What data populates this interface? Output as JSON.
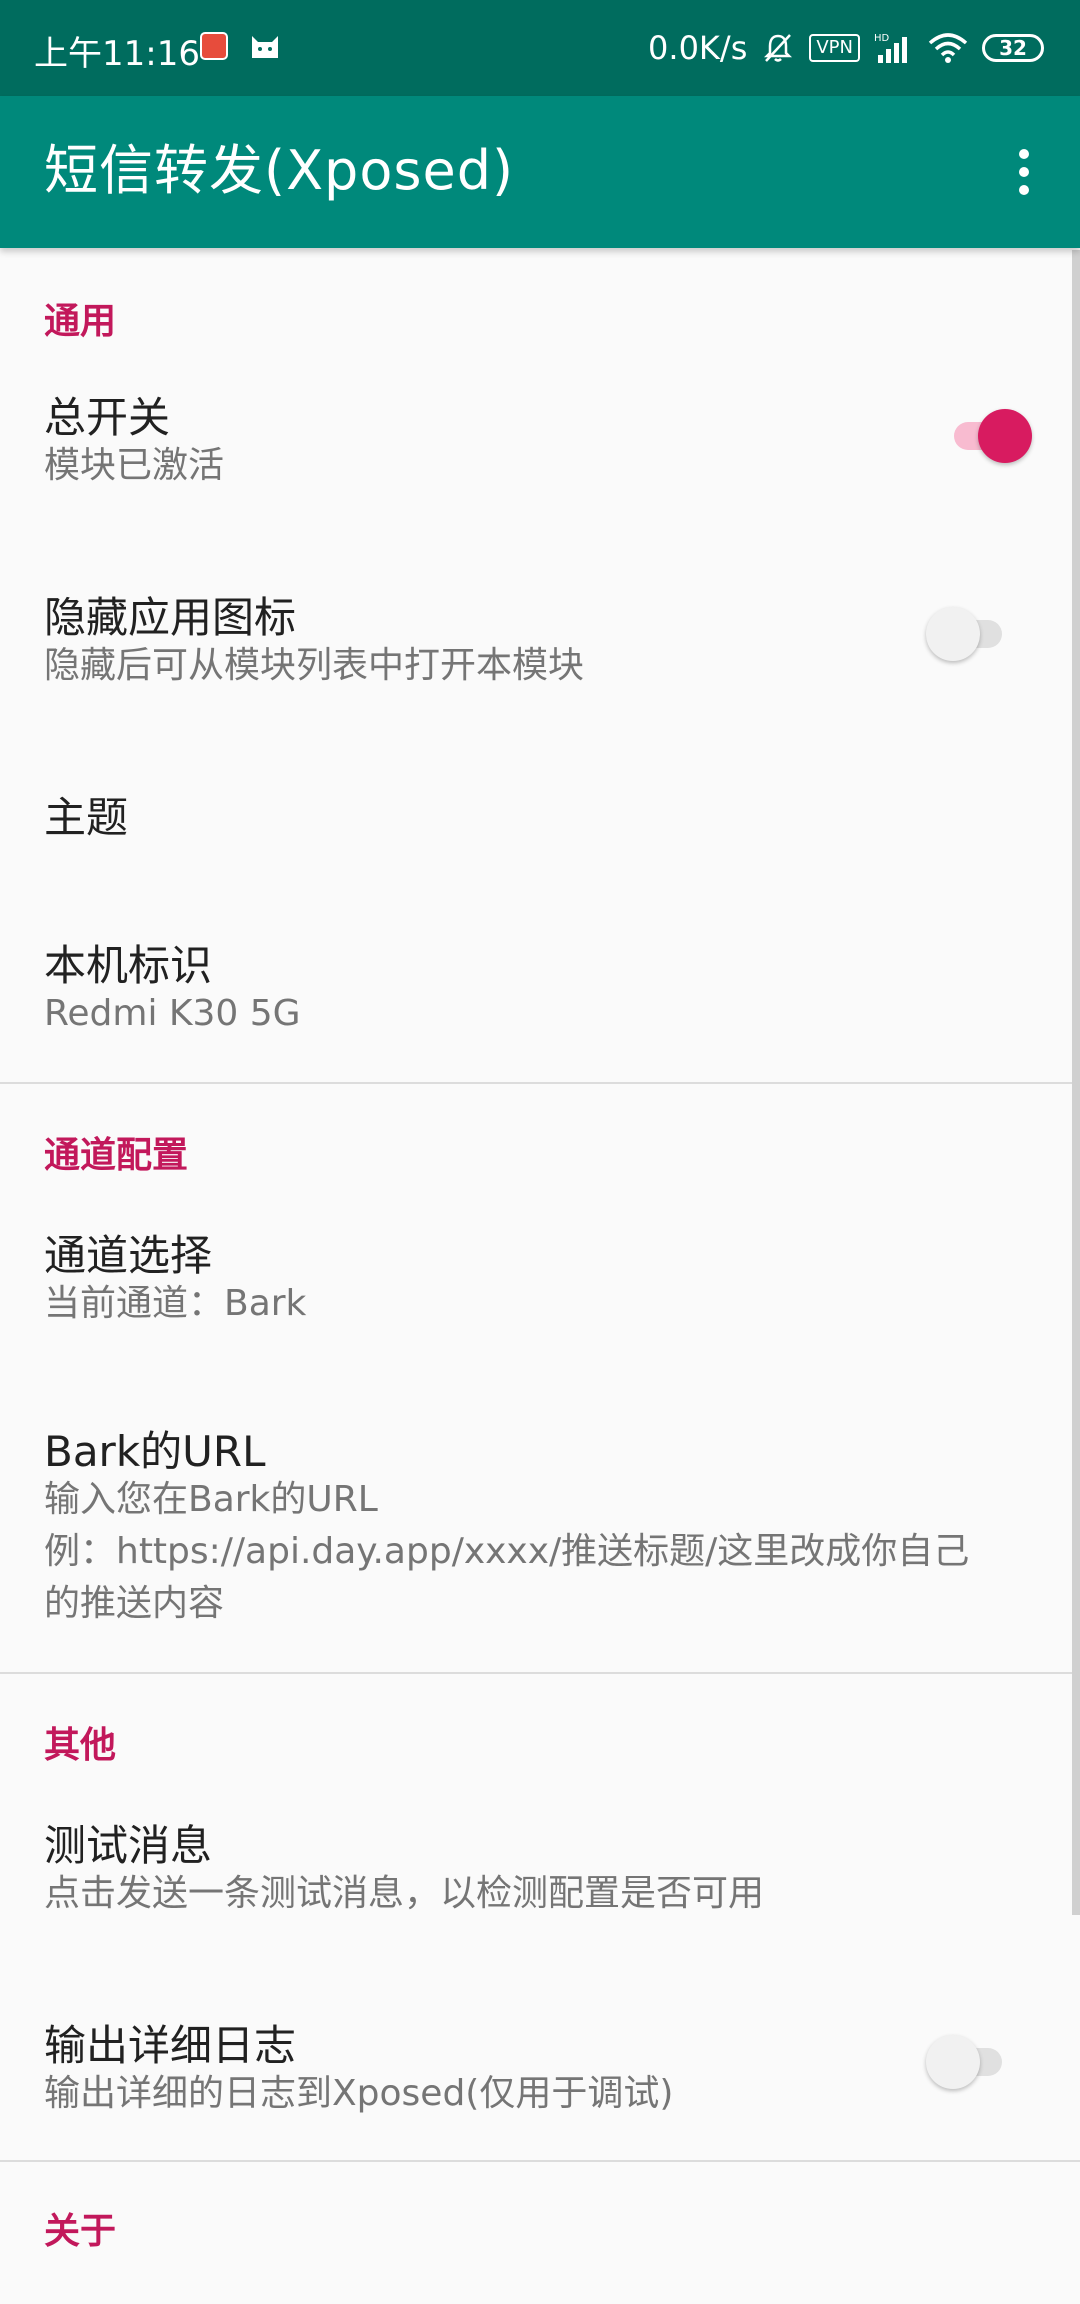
{
  "status_bar": {
    "time": "上午11:16",
    "net_speed": "0.0K/s",
    "vpn": "VPN",
    "battery": "32"
  },
  "app_bar": {
    "title": "短信转发(Xposed)"
  },
  "sections": {
    "general": {
      "header": "通用",
      "master_switch": {
        "title": "总开关",
        "summary": "模块已激活",
        "on": true
      },
      "hide_icon": {
        "title": "隐藏应用图标",
        "summary": "隐藏后可从模块列表中打开本模块",
        "on": false
      },
      "theme": {
        "title": "主题"
      },
      "device_id": {
        "title": "本机标识",
        "summary": "Redmi K30 5G"
      }
    },
    "channel": {
      "header": "通道配置",
      "channel_select": {
        "title": "通道选择",
        "summary": "当前通道：Bark"
      },
      "bark_url": {
        "title": "Bark的URL",
        "summary_line1": "输入您在Bark的URL",
        "summary_line2": "例：https://api.day.app/xxxx/推送标题/这里改成你自己",
        "summary_line3": "的推送内容"
      }
    },
    "other": {
      "header": "其他",
      "test_message": {
        "title": "测试消息",
        "summary": "点击发送一条测试消息，以检测配置是否可用"
      },
      "verbose_log": {
        "title": "输出详细日志",
        "summary": "输出详细的日志到Xposed(仅用于调试)",
        "on": false
      }
    },
    "about": {
      "header": "关于"
    }
  },
  "colors": {
    "status_bar": "#006c5e",
    "app_bar": "#00897b",
    "accent": "#d81b60",
    "section_header": "#c2185b"
  }
}
